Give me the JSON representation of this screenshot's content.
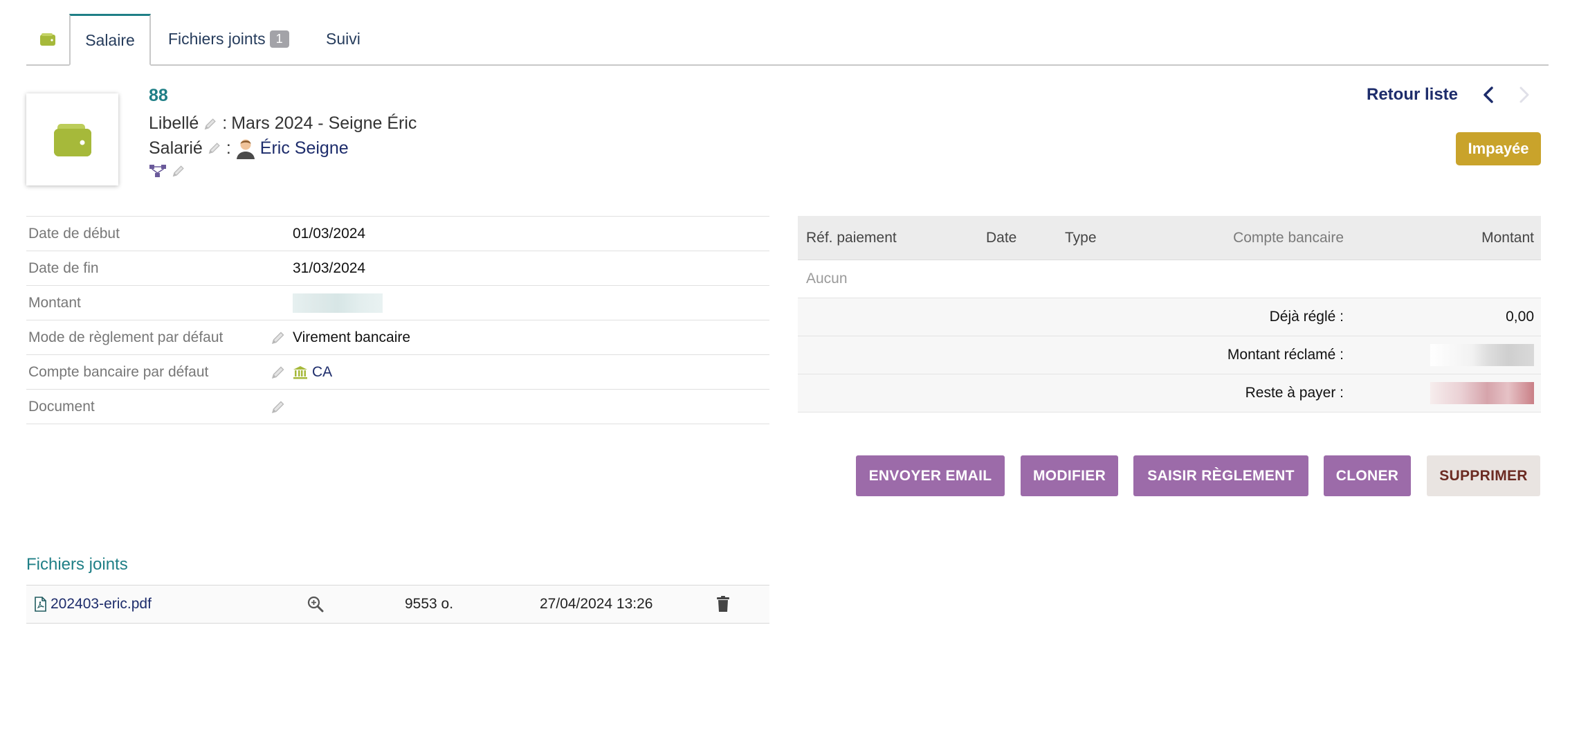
{
  "tabs": {
    "salary_label": "Salaire",
    "attachments_label": "Fichiers joints",
    "attachments_count": "1",
    "followup_label": "Suivi"
  },
  "header": {
    "ref": "88",
    "label_key": "Libellé",
    "label_sep": ":",
    "label_value": "Mars 2024 - Seigne Éric",
    "employee_key": "Salarié",
    "employee_sep": ":",
    "employee_value": "Éric Seigne",
    "back_to_list": "Retour liste",
    "status": "Impayée",
    "status_color": "#c9a32b"
  },
  "fields": [
    {
      "label": "Date de début",
      "value": "01/03/2024"
    },
    {
      "label": "Date de fin",
      "value": "31/03/2024"
    },
    {
      "label": "Montant",
      "value": ""
    },
    {
      "label": "Mode de règlement par défaut",
      "value": "Virement bancaire"
    },
    {
      "label": "Compte bancaire par défaut",
      "value": "CA"
    },
    {
      "label": "Document",
      "value": ""
    }
  ],
  "payments": {
    "columns": [
      "Réf. paiement",
      "Date",
      "Type",
      "Compte bancaire",
      "Montant"
    ],
    "empty_text": "Aucun",
    "already_paid_label": "Déjà réglé :",
    "already_paid_value": "0,00",
    "claimed_label": "Montant réclamé :",
    "remaining_label": "Reste à payer :"
  },
  "actions": {
    "send_email": "ENVOYER EMAIL",
    "modify": "MODIFIER",
    "enter_payment": "SAISIR RÈGLEMENT",
    "clone": "CLONER",
    "delete": "SUPPRIMER",
    "button_color": "#9c6ba9"
  },
  "attachments": {
    "title": "Fichiers joints",
    "files": [
      {
        "name": "202403-eric.pdf",
        "size": "9553 o.",
        "date": "27/04/2024 13:26"
      }
    ]
  },
  "icons": {
    "wallet": "wallet-icon",
    "pencil": "pencil-icon",
    "bank": "bank-icon",
    "user": "user-avatar-icon",
    "hierarchy": "hierarchy-icon",
    "zoom": "zoom-icon",
    "trash": "trash-icon",
    "pdf": "pdf-file-icon"
  },
  "colors": {
    "accent": "#1f7f86",
    "link": "#1d2c6b",
    "wallet": "#a6b93a"
  }
}
